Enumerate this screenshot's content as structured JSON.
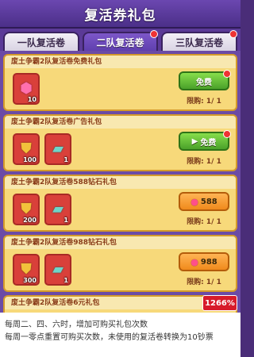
{
  "window": {
    "title": "复活券礼包"
  },
  "tabs": [
    {
      "label": "一队复活卷",
      "active": false,
      "notify": false
    },
    {
      "label": "二队复活卷",
      "active": true,
      "notify": true
    },
    {
      "label": "三队复活卷",
      "active": false,
      "notify": true
    }
  ],
  "packs": [
    {
      "title": "废土争霸2队复活卷免费礼包",
      "items": [
        {
          "icon": "gem-icon",
          "count": "10"
        }
      ],
      "button": {
        "label": "免费",
        "style": "green",
        "icon": "",
        "notify": true
      },
      "limit": "限购: 1/ 1"
    },
    {
      "title": "废土争霸2队复活卷广告礼包",
      "items": [
        {
          "icon": "gold-shield-icon",
          "count": "100"
        },
        {
          "icon": "revive-ticket-icon",
          "count": "1"
        }
      ],
      "button": {
        "label": "免费",
        "style": "green",
        "icon": "video-ad-icon",
        "notify": true
      },
      "limit": "限购: 1/ 1"
    },
    {
      "title": "废土争霸2队复活卷588钻石礼包",
      "items": [
        {
          "icon": "gold-shield-icon",
          "count": "200"
        },
        {
          "icon": "revive-ticket-icon",
          "count": "1"
        }
      ],
      "button": {
        "label": "588",
        "style": "orange",
        "icon": "gem-icon",
        "notify": false
      },
      "limit": "限购: 1/ 1"
    },
    {
      "title": "废土争霸2队复活卷988钻石礼包",
      "items": [
        {
          "icon": "gold-shield-icon",
          "count": "300"
        },
        {
          "icon": "revive-ticket-icon",
          "count": "1"
        }
      ],
      "button": {
        "label": "988",
        "style": "orange",
        "icon": "gem-icon",
        "notify": false
      },
      "limit": "限购: 1/ 1"
    },
    {
      "title": "废土争霸2队复活卷6元礼包",
      "items": [],
      "button": null,
      "limit": ""
    }
  ],
  "badge": "1266%",
  "footer": {
    "line1": "每周二、四、六时，增加可购买礼包次数",
    "line2": "每周一零点重置可购买次数，未使用的复活卷转换为10钞票"
  },
  "colors": {
    "header_bg": "#4b2f88",
    "tab_active": "#5f3fae",
    "card_bg": "#f7d97a",
    "free_button": "#4aa12a",
    "price_button": "#f08a1c",
    "badge": "#d71b2a"
  }
}
